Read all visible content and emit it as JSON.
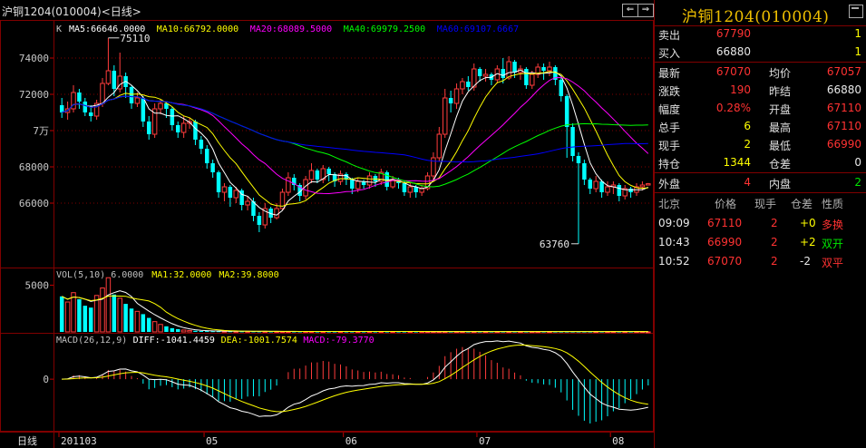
{
  "title_bar": {
    "text": "沪铜1204(010004)<日线>"
  },
  "panel": {
    "title": "沪铜1204(010004)",
    "quote": [
      {
        "label": "卖出",
        "value": "67790",
        "value_color": "red",
        "label2": "",
        "value2": "1",
        "value2_color": "yellow"
      },
      {
        "label": "买入",
        "value": "66880",
        "value_color": "white",
        "label2": "",
        "value2": "1",
        "value2_color": "yellow"
      },
      {
        "label": "最新",
        "value": "67070",
        "value_color": "red",
        "label2": "均价",
        "value2": "67057",
        "value2_color": "red"
      },
      {
        "label": "涨跌",
        "value": "190",
        "value_color": "red",
        "label2": "昨结",
        "value2": "66880",
        "value2_color": "white"
      },
      {
        "label": "幅度",
        "value": "0.28%",
        "value_color": "red",
        "label2": "开盘",
        "value2": "67110",
        "value2_color": "red"
      },
      {
        "label": "总手",
        "value": "6",
        "value_color": "yellow",
        "label2": "最高",
        "value2": "67110",
        "value2_color": "red"
      },
      {
        "label": "现手",
        "value": "2",
        "value_color": "yellow",
        "label2": "最低",
        "value2": "66990",
        "value2_color": "red"
      },
      {
        "label": "持仓",
        "value": "1344",
        "value_color": "yellow",
        "label2": "仓差",
        "value2": "0",
        "value2_color": "white"
      },
      {
        "label": "外盘",
        "value": "4",
        "value_color": "red",
        "label2": "内盘",
        "value2": "2",
        "value2_color": "green"
      }
    ],
    "trades_header": [
      "北京",
      "价格",
      "现手",
      "仓差",
      "性质"
    ],
    "trades": [
      {
        "time": "09:09",
        "price": "67110",
        "vol": "2",
        "oi": "+0",
        "nature": "多换",
        "nature_color": "red"
      },
      {
        "time": "10:43",
        "price": "66990",
        "vol": "2",
        "oi": "+2",
        "nature": "双开",
        "nature_color": "green"
      },
      {
        "time": "10:52",
        "price": "67070",
        "vol": "2",
        "oi": "-2",
        "nature": "双平",
        "nature_color": "red"
      }
    ]
  },
  "chart_data": {
    "type": "candlestick",
    "main_legend": {
      "k": "K",
      "items": [
        {
          "text": "MA5:66646.0000",
          "color": "#ffffff"
        },
        {
          "text": "MA10:66792.0000",
          "color": "#ffff00"
        },
        {
          "text": "MA20:68089.5000",
          "color": "#ff00ff"
        },
        {
          "text": "MA40:69979.2500",
          "color": "#00ff00"
        },
        {
          "text": "MA60:69107.6667",
          "color": "#0000ff"
        }
      ]
    },
    "y_ticks": [
      {
        "value": 74000,
        "label": "74000"
      },
      {
        "value": 72000,
        "label": "72000"
      },
      {
        "value": 70000,
        "label": "7万"
      },
      {
        "value": 68000,
        "label": "68000"
      },
      {
        "value": 66000,
        "label": "66000"
      }
    ],
    "y_range": [
      62700,
      75700
    ],
    "annotations": [
      {
        "label": "75110",
        "value": 75110
      },
      {
        "label": "63760",
        "value": 63760
      }
    ],
    "candles": [
      [
        71400,
        71000,
        71800,
        70700
      ],
      [
        71000,
        71200,
        71600,
        70600
      ],
      [
        71200,
        72100,
        72500,
        71000
      ],
      [
        72100,
        71600,
        72300,
        71200
      ],
      [
        71600,
        71000,
        71800,
        70800
      ],
      [
        71000,
        70800,
        71400,
        70500
      ],
      [
        70800,
        71500,
        71700,
        70600
      ],
      [
        71500,
        72600,
        72900,
        71300
      ],
      [
        72600,
        73300,
        75110,
        72500
      ],
      [
        73300,
        72300,
        73600,
        71900
      ],
      [
        72300,
        73000,
        74300,
        72100
      ],
      [
        73000,
        72400,
        73200,
        71800
      ],
      [
        72400,
        71500,
        72500,
        71200
      ],
      [
        71500,
        71800,
        72100,
        71300
      ],
      [
        71800,
        70500,
        71900,
        70200
      ],
      [
        70500,
        69800,
        70800,
        69500
      ],
      [
        69800,
        71200,
        71500,
        69600
      ],
      [
        71200,
        71500,
        71700,
        70900
      ],
      [
        71500,
        71200,
        71600,
        70700
      ],
      [
        71200,
        70300,
        71300,
        70000
      ],
      [
        70300,
        69900,
        70500,
        69600
      ],
      [
        69900,
        70400,
        70800,
        69600
      ],
      [
        70400,
        70500,
        70700,
        70100
      ],
      [
        70500,
        69500,
        70600,
        69200
      ],
      [
        69500,
        69000,
        69700,
        68700
      ],
      [
        69000,
        68200,
        69200,
        67900
      ],
      [
        68200,
        67700,
        68400,
        67400
      ],
      [
        67700,
        66600,
        67800,
        66300
      ],
      [
        66600,
        66900,
        67100,
        66100
      ],
      [
        66900,
        66300,
        67000,
        65800
      ],
      [
        66300,
        66700,
        66900,
        66000
      ],
      [
        66700,
        65900,
        66800,
        65600
      ],
      [
        65900,
        66100,
        66400,
        65600
      ],
      [
        66100,
        65300,
        66300,
        65000
      ],
      [
        65300,
        64800,
        65500,
        64400
      ],
      [
        64800,
        65700,
        66000,
        64600
      ],
      [
        65700,
        65200,
        65800,
        64900
      ],
      [
        65200,
        65700,
        66000,
        65100
      ],
      [
        65700,
        66600,
        66800,
        65600
      ],
      [
        66600,
        67400,
        67700,
        66400
      ],
      [
        67400,
        67000,
        67600,
        66700
      ],
      [
        67000,
        66400,
        67100,
        66100
      ],
      [
        66400,
        67300,
        67500,
        66200
      ],
      [
        67300,
        67800,
        68200,
        67100
      ],
      [
        67800,
        67300,
        67900,
        67100
      ],
      [
        67300,
        67900,
        68100,
        67100
      ],
      [
        67900,
        67600,
        68000,
        67200
      ],
      [
        67600,
        67200,
        67700,
        66900
      ],
      [
        67200,
        67600,
        67800,
        67000
      ],
      [
        67600,
        67300,
        67700,
        67000
      ],
      [
        67300,
        66800,
        67400,
        66500
      ],
      [
        66800,
        67200,
        67400,
        66600
      ],
      [
        67200,
        67000,
        67300,
        66800
      ],
      [
        67000,
        67500,
        67700,
        66800
      ],
      [
        67500,
        67200,
        67600,
        66900
      ],
      [
        67200,
        67700,
        67900,
        67000
      ],
      [
        67700,
        66900,
        67800,
        66700
      ],
      [
        66900,
        67300,
        67500,
        66800
      ],
      [
        67300,
        67100,
        67400,
        66800
      ],
      [
        67100,
        66600,
        67200,
        66400
      ],
      [
        66600,
        66900,
        67100,
        66300
      ],
      [
        66900,
        66600,
        67000,
        66300
      ],
      [
        66600,
        66800,
        67000,
        66400
      ],
      [
        66800,
        67500,
        67700,
        66700
      ],
      [
        67500,
        68500,
        68800,
        67300
      ],
      [
        68500,
        69800,
        70200,
        68300
      ],
      [
        69800,
        71800,
        72300,
        69600
      ],
      [
        71800,
        71500,
        72200,
        71000
      ],
      [
        71500,
        72300,
        72600,
        71200
      ],
      [
        72300,
        72700,
        72900,
        72000
      ],
      [
        72700,
        72400,
        73000,
        72200
      ],
      [
        72400,
        73400,
        73700,
        72200
      ],
      [
        73400,
        73000,
        73500,
        72700
      ],
      [
        73000,
        73100,
        73400,
        72700
      ],
      [
        73100,
        72800,
        73200,
        72500
      ],
      [
        72800,
        73400,
        73600,
        72600
      ],
      [
        73400,
        72900,
        74000,
        72600
      ],
      [
        72900,
        73800,
        74100,
        72800
      ],
      [
        73800,
        73200,
        73900,
        72900
      ],
      [
        73200,
        73400,
        73600,
        72800
      ],
      [
        73400,
        72500,
        73500,
        72300
      ],
      [
        72500,
        73100,
        73300,
        72300
      ],
      [
        73100,
        73500,
        73700,
        72900
      ],
      [
        73500,
        73300,
        73700,
        72800
      ],
      [
        73300,
        73500,
        73800,
        73000
      ],
      [
        73500,
        72800,
        73600,
        72500
      ],
      [
        72800,
        71900,
        72900,
        71600
      ],
      [
        71900,
        70200,
        72000,
        68500
      ],
      [
        70200,
        68600,
        70400,
        68300
      ],
      [
        68600,
        68200,
        68800,
        63760
      ],
      [
        68200,
        67300,
        68400,
        67000
      ],
      [
        67300,
        66800,
        67400,
        66500
      ],
      [
        66800,
        67200,
        67500,
        66600
      ],
      [
        67200,
        66600,
        67300,
        66300
      ],
      [
        66600,
        66900,
        67200,
        66400
      ],
      [
        66900,
        67000,
        67200,
        66500
      ],
      [
        67000,
        66400,
        67100,
        66100
      ],
      [
        66400,
        66800,
        67000,
        66200
      ],
      [
        66800,
        66600,
        66900,
        66300
      ],
      [
        66600,
        66900,
        67100,
        66400
      ],
      [
        66900,
        67000,
        67200,
        66700
      ],
      [
        67000,
        67070,
        67110,
        66990
      ]
    ],
    "vol_panel": {
      "legend": [
        {
          "text": "VOL(5,10) 6.0000",
          "color": "#c0c0c0"
        },
        {
          "text": "MA1:32.0000",
          "color": "#ffff00"
        },
        {
          "text": "MA2:39.8000",
          "color": "#ffff00"
        }
      ],
      "y_ticks": [
        {
          "value": 5000,
          "label": "5000"
        }
      ],
      "y_max": 6500,
      "volumes": [
        3800,
        3200,
        4200,
        3500,
        2800,
        2600,
        3900,
        4700,
        5800,
        4000,
        3600,
        3000,
        2500,
        2200,
        1900,
        1500,
        1100,
        800,
        600,
        400,
        300,
        200,
        150,
        120,
        100,
        90,
        80,
        80,
        70,
        70,
        60,
        60,
        60,
        60,
        55,
        55,
        50,
        50,
        50,
        50,
        50,
        50,
        50,
        50,
        45,
        45,
        45,
        45,
        45,
        45,
        45,
        45,
        45,
        45,
        45,
        45,
        45,
        45,
        45,
        45,
        45,
        45,
        40,
        40,
        40,
        40,
        40,
        40,
        40,
        40,
        40,
        40,
        40,
        40,
        40,
        40,
        40,
        40,
        40,
        40,
        40,
        40,
        40,
        40,
        40,
        40,
        40,
        40,
        40,
        40,
        40,
        40,
        40,
        40,
        40,
        40,
        40,
        40,
        40,
        40,
        40,
        6
      ]
    },
    "macd_panel": {
      "legend": [
        {
          "text": "MACD(26,12,9)",
          "color": "#c0c0c0"
        },
        {
          "text": "DIFF:-1041.4459",
          "color": "#ffffff"
        },
        {
          "text": "DEA:-1001.7574",
          "color": "#ffff00"
        },
        {
          "text": "MACD:-79.3770",
          "color": "#ff00ff"
        }
      ],
      "y_ticks": [
        {
          "value": 0,
          "label": "0"
        }
      ],
      "y_range": [
        -2000,
        1600
      ]
    },
    "x_labels": [
      {
        "label": "日线",
        "index": -1
      },
      {
        "label": "201103",
        "index": 0
      },
      {
        "label": "05",
        "index": 25
      },
      {
        "label": "06",
        "index": 49
      },
      {
        "label": "07",
        "index": 72
      },
      {
        "label": "08",
        "index": 95
      }
    ]
  }
}
